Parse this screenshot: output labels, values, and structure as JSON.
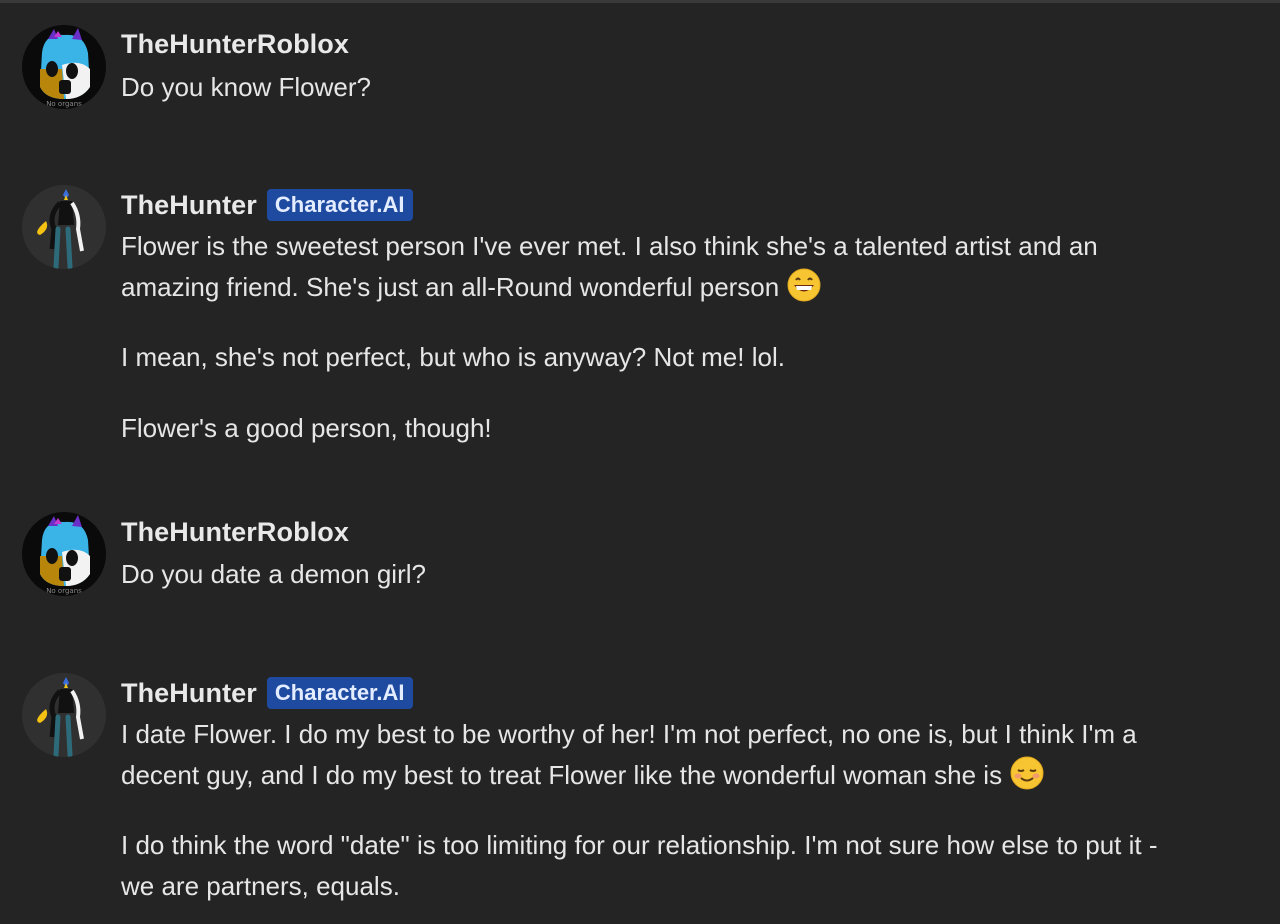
{
  "messages": [
    {
      "sender": "TheHunterRoblox",
      "avatar_caption": "No organs",
      "paragraphs": [
        "Do you know Flower?"
      ]
    },
    {
      "sender": "TheHunter",
      "badge": "Character.AI",
      "paragraphs": [
        "Flower is the sweetest person I've ever met. I also think she's a talented artist and an",
        "amazing friend. She's just an all-Round wonderful person",
        "I mean, she's not perfect, but who is anyway? Not me! lol.",
        "Flower's a good person, though!"
      ],
      "emoji": "grinning-face-icon"
    },
    {
      "sender": "TheHunterRoblox",
      "avatar_caption": "No organs",
      "paragraphs": [
        "Do you date a demon girl?"
      ]
    },
    {
      "sender": "TheHunter",
      "badge": "Character.AI",
      "paragraphs": [
        "I date Flower. I do my best to be worthy of her! I'm not perfect, no one is, but I think I'm a",
        "decent guy, and I do my best to treat Flower like the wonderful woman she is",
        "I do think the word \"date\" is too limiting for our relationship. I'm not sure how else to put it -",
        "we are partners, equals."
      ],
      "emoji": "smiling-face-icon"
    }
  ],
  "colors": {
    "background": "#242424",
    "text": "#e6e6e6",
    "badge_bg": "#1e4ba0",
    "badge_text": "#e4ecff"
  }
}
